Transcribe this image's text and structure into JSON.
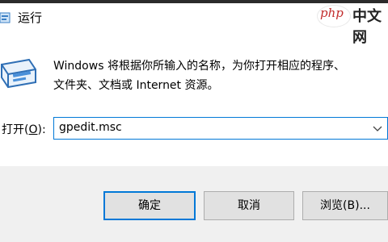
{
  "window": {
    "title": "运行"
  },
  "watermark": {
    "brand_latin": "php",
    "brand_cn": "中文网"
  },
  "description": {
    "line1": "Windows 将根据你所输入的名称，为你打开相应的程序、",
    "line2": "文件夹、文档或 Internet 资源。"
  },
  "open": {
    "label_prefix": "打开(",
    "label_key": "O",
    "label_suffix": "):",
    "value": "gpedit.msc"
  },
  "buttons": {
    "ok": "确定",
    "cancel": "取消",
    "browse": "浏览(B)..."
  },
  "icons": {
    "title": "run-icon",
    "large": "run-dialog-icon",
    "dropdown": "chevron-down-icon"
  },
  "colors": {
    "accent": "#0078d7",
    "footer_bg": "#f0f0f0",
    "button_bg": "#e1e1e1"
  }
}
